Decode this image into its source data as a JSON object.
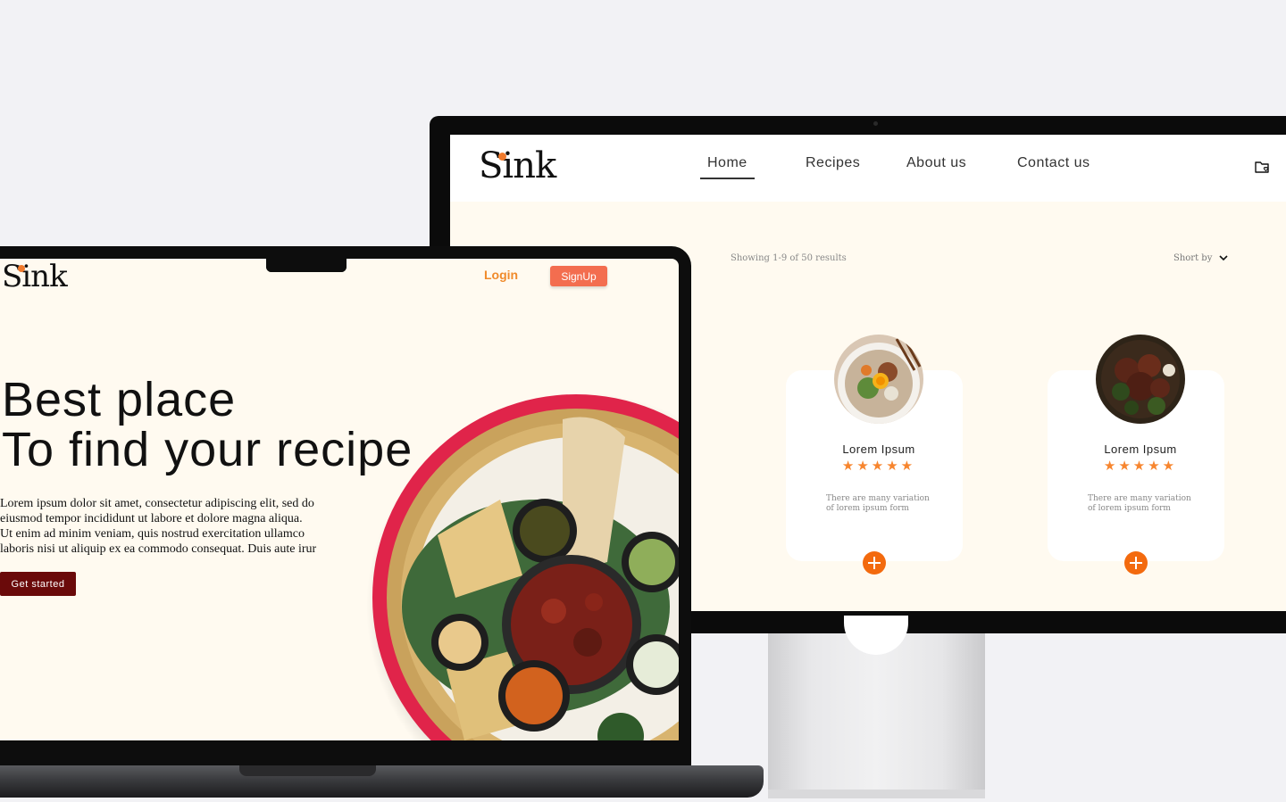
{
  "desktop": {
    "logo": "Sink",
    "nav": [
      {
        "label": "Home",
        "active": true
      },
      {
        "label": "Recipes",
        "active": false
      },
      {
        "label": "About us",
        "active": false
      },
      {
        "label": "Contact us",
        "active": false
      }
    ],
    "header_icon": "folder-heart-icon",
    "results_text": "Showing 1-9 of 50 results",
    "sort_label": "Short by",
    "cards": [
      {
        "title": "Lorem Ipsum",
        "rating": 5,
        "stars": "★★★★★",
        "description_line1": "There are many variation",
        "description_line2": "of lorem ipsum form"
      },
      {
        "title": "Lorem Ipsum",
        "rating": 5,
        "stars": "★★★★★",
        "description_line1": "There are many variation",
        "description_line2": "of lorem ipsum form"
      }
    ]
  },
  "laptop": {
    "logo": "Sink",
    "login_label": "Login",
    "signup_label": "SignUp",
    "hero_line1": "Best place",
    "hero_line2": "To find your recipe",
    "body_line1": "Lorem ipsum dolor sit amet, consectetur adipiscing elit, sed do",
    "body_line2": "eiusmod tempor incididunt ut labore et dolore magna aliqua.",
    "body_line3": "Ut enim ad minim veniam, quis nostrud exercitation ullamco",
    "body_line4": "laboris nisi ut aliquip ex ea commodo consequat. Duis aute irur",
    "cta_label": "Get started"
  },
  "colors": {
    "accent": "#f36a0e",
    "signup": "#f36d4f",
    "cta": "#6a0a0a",
    "cream": "#fffaf0",
    "page_bg": "#f2f2f5"
  }
}
